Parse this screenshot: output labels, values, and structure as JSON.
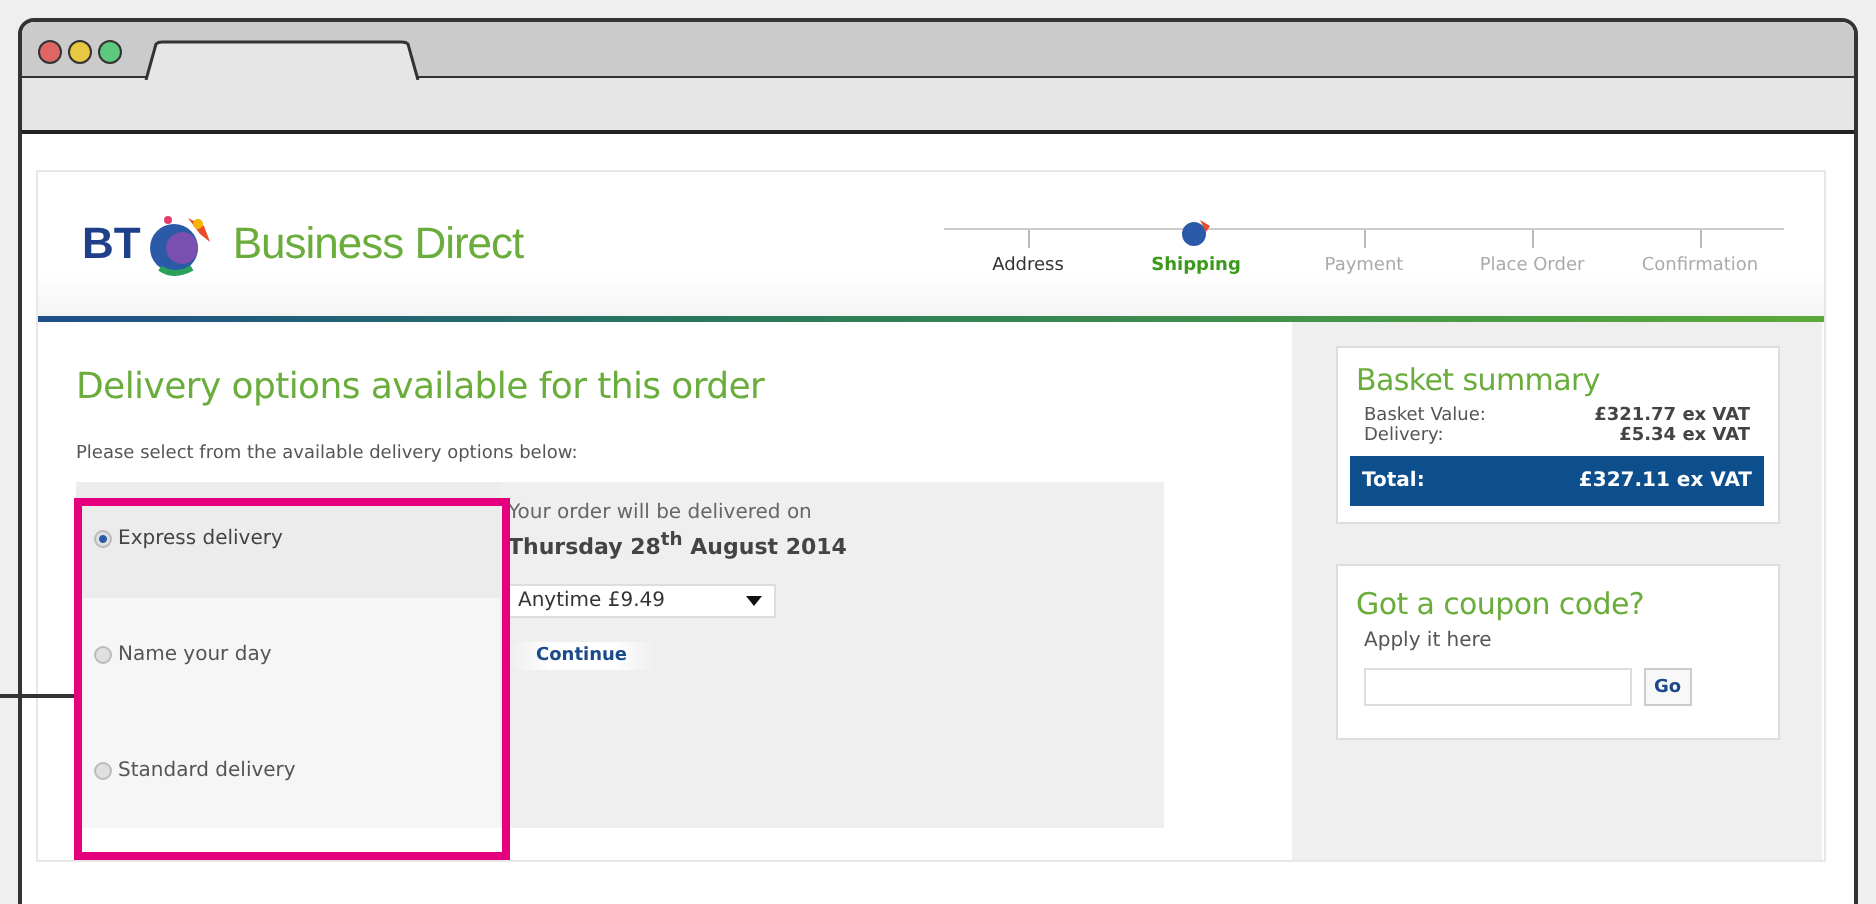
{
  "brand": {
    "logo_text": "BT",
    "name": "Business Direct"
  },
  "steps": [
    {
      "label": "Address",
      "selected": false,
      "completed": true
    },
    {
      "label": "Shipping",
      "selected": true,
      "completed": false
    },
    {
      "label": "Payment",
      "selected": false,
      "completed": false
    },
    {
      "label": "Place Order",
      "selected": false,
      "completed": false
    },
    {
      "label": "Confirmation",
      "selected": false,
      "completed": false
    }
  ],
  "heading": "Delivery options available for this order",
  "instruction": "Please select from the available delivery options below:",
  "options": [
    {
      "label": "Express delivery",
      "selected": true
    },
    {
      "label": "Name your day",
      "selected": false
    },
    {
      "label": "Standard delivery",
      "selected": false
    }
  ],
  "delivery": {
    "intro": "Your order will be delivered on",
    "date": "Thursday 28$^{th}$ August 2014",
    "slot": "Anytime £9.49",
    "button": "Continue"
  },
  "basket": {
    "title": "Basket summary",
    "rows": [
      {
        "label": "Basket Value:",
        "value": "£321.77 ex VAT"
      },
      {
        "label": "Delivery:",
        "value": "£5.34 ex VAT"
      }
    ],
    "total_label": "Total:",
    "total_value": "£327.11 ex VAT"
  },
  "coupon": {
    "title": "Got a coupon code?",
    "hint": "Apply it here",
    "button": "Go"
  }
}
